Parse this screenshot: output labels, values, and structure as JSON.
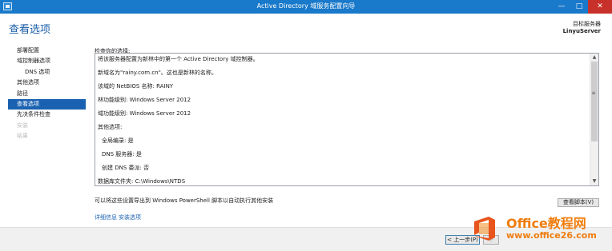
{
  "window": {
    "title": "Active Directory 域服务配置向导",
    "minimize": "—",
    "maximize": "□",
    "close": "✕"
  },
  "header": {
    "page_title": "查看选项",
    "target_label": "目标服务器",
    "target_name": "LinyuServer"
  },
  "nav": {
    "items": [
      {
        "label": "部署配置"
      },
      {
        "label": "域控制器选项"
      },
      {
        "label": "DNS 选项"
      },
      {
        "label": "其他选项"
      },
      {
        "label": "路径"
      },
      {
        "label": "查看选项"
      },
      {
        "label": "先决条件检查"
      },
      {
        "label": "安装"
      },
      {
        "label": "结果"
      }
    ]
  },
  "review": {
    "label": "检查你的选择:",
    "lines": [
      "将该服务器配置为新林中的第一个 Active Directory 域控制器。",
      "新域名为\"rainy.com.cn\"。这也是新林的名称。",
      "该域的 NetBIOS 名称: RAINY",
      "林功能级别: Windows Server 2012",
      "域功能级别: Windows Server 2012",
      "其他选项:",
      "全局编录: 是",
      "DNS 服务器: 是",
      "创建 DNS 委派: 否",
      "数据库文件夹: C:\\Windows\\NTDS"
    ],
    "scroll_up": "▲",
    "scroll_down": "▼",
    "scroll_grip": "≡"
  },
  "export_note": "可以将这些设置导出到 Windows PowerShell 脚本以自动执行其他安装",
  "view_script_button": "查看脚本(V)",
  "more_info": {
    "link1": "详细信息",
    "link2": "安装选项"
  },
  "footer": {
    "prev_button": "< 上一步(P)",
    "next_button": "下"
  },
  "watermark": {
    "line1": "Office教程网",
    "line2": "www.office26.com",
    "colors": {
      "orange": "#ef7d0d",
      "red": "#d9321c"
    }
  }
}
